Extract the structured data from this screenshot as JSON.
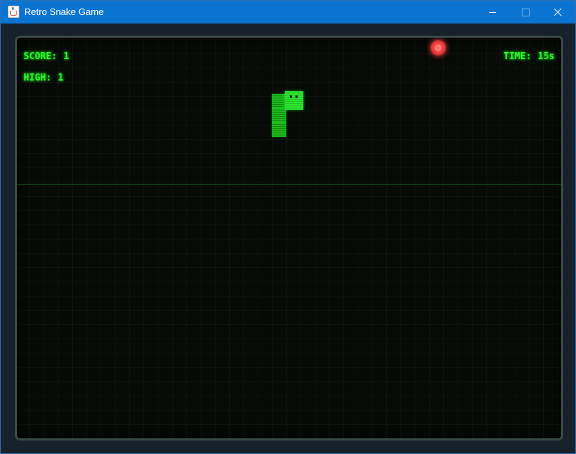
{
  "window": {
    "title": "Retro Snake Game",
    "app_icon": "java-cup-icon",
    "controls": [
      "minimize-icon",
      "maximize-icon",
      "close-icon"
    ]
  },
  "hud": {
    "score_label": "SCORE:",
    "score_value": "1",
    "high_label": "HIGH:",
    "high_value": "1",
    "time_label": "TIME:",
    "time_value": "15s"
  },
  "game": {
    "snake_direction": "up",
    "colors": {
      "hud_text": "#2df52d",
      "snake": "#22c222",
      "food": "#ff4b4b",
      "board_background": "#070a07",
      "titlebar": "#0b74d1"
    }
  }
}
